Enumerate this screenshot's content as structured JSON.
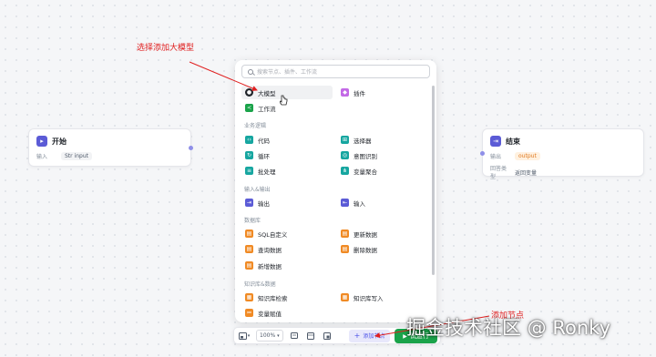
{
  "start_node": {
    "title": "开始",
    "row_label": "输入",
    "row_value": "input"
  },
  "end_node": {
    "title": "结束",
    "output_label": "输出",
    "output_value": "output",
    "answer_label": "回答类型",
    "answer_value": "返回变量"
  },
  "panel": {
    "search_placeholder": "搜索节点、插件、工作流",
    "top_items": [
      {
        "label": "大模型",
        "color": "#1f2329"
      },
      {
        "label": "插件",
        "color": "#c36ae6"
      },
      {
        "label": "工作流",
        "color": "#1aa34a"
      }
    ],
    "sections": [
      {
        "title": "业务逻辑",
        "items": [
          {
            "label": "代码",
            "color": "#16a6a0"
          },
          {
            "label": "选择器",
            "color": "#16a6a0"
          },
          {
            "label": "循环",
            "color": "#16a6a0"
          },
          {
            "label": "意图识别",
            "color": "#16a6a0"
          },
          {
            "label": "批处理",
            "color": "#16a6a0"
          },
          {
            "label": "变量聚合",
            "color": "#16a6a0"
          }
        ]
      },
      {
        "title": "输入&输出",
        "items": [
          {
            "label": "输出",
            "color": "#5b5bd6"
          },
          {
            "label": "输入",
            "color": "#5b5bd6"
          }
        ]
      },
      {
        "title": "数据库",
        "items": [
          {
            "label": "SQL自定义",
            "color": "#f08a24"
          },
          {
            "label": "更新数据",
            "color": "#f08a24"
          },
          {
            "label": "查询数据",
            "color": "#f08a24"
          },
          {
            "label": "删除数据",
            "color": "#f08a24"
          },
          {
            "label": "新增数据",
            "color": "#f08a24"
          }
        ]
      },
      {
        "title": "知识库&数据",
        "items": [
          {
            "label": "知识库检索",
            "color": "#f08a24"
          },
          {
            "label": "知识库写入",
            "color": "#f08a24"
          },
          {
            "label": "变量赋值",
            "color": "#f08a24"
          }
        ]
      }
    ]
  },
  "toolbar": {
    "zoom": "100%",
    "add_node": "添加节点",
    "run": "试运行"
  },
  "annotations": {
    "select_llm": "选择添加大模型",
    "add_node": "添加节点"
  },
  "watermark": "掘金技术社区 @ Ronky",
  "colors": {
    "accent": "#4d53e8",
    "annotation": "#e02020",
    "run": "#1aa34a"
  }
}
